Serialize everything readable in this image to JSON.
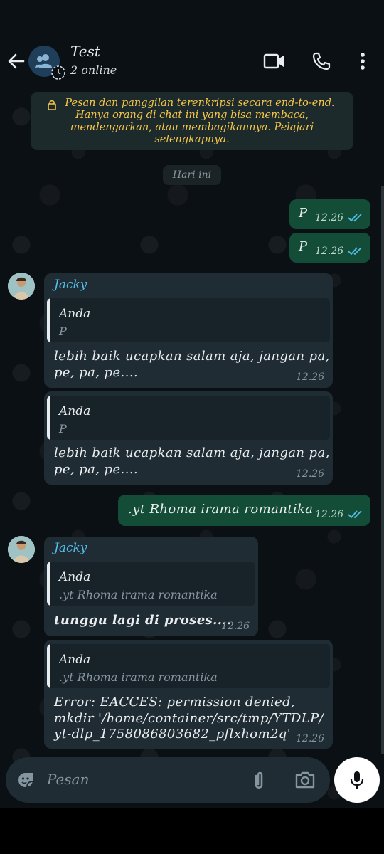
{
  "header": {
    "title": "Test",
    "subtitle": "2 online",
    "icons": [
      "back-arrow-icon",
      "group-avatar-icon",
      "video-call-icon",
      "voice-call-icon",
      "more-vert-icon"
    ]
  },
  "notice": {
    "text": "Pesan dan panggilan terenkripsi secara end-to-end. Hanya orang di chat ini yang bisa membaca, mendengarkan, atau membagikannya. Pelajari selengkapnya.",
    "line1": "Pesan dan panggilan terenkripsi secara end-to-end.",
    "line2": "Hanya orang di chat ini yang bisa membaca,",
    "line3": "mendengarkan, atau membagikannya. Pelajari",
    "line4": "selengkapnya."
  },
  "date_chip": "Hari ini",
  "messages": {
    "m1": {
      "text": "P",
      "time": "12.26"
    },
    "m2": {
      "text": "P",
      "time": "12.26"
    },
    "m3": {
      "sender": "Jacky",
      "quote_author": "Anda",
      "quote_text": "P",
      "line1": "lebih baik ucapkan salam aja, jangan pa,",
      "line2": "pe, pa, pe....",
      "time": "12.26"
    },
    "m4": {
      "quote_author": "Anda",
      "quote_text": "P",
      "line1": "lebih baik ucapkan salam aja, jangan pa,",
      "line2": "pe, pa, pe....",
      "time": "12.26"
    },
    "m5": {
      "text": ".yt Rhoma irama romantika",
      "time": "12.26"
    },
    "m6": {
      "sender": "Jacky",
      "quote_author": "Anda",
      "quote_text": ".yt Rhoma irama romantika",
      "text": "tunggu lagi di proses....",
      "time": "12.26"
    },
    "m7": {
      "quote_author": "Anda",
      "quote_text": ".yt Rhoma irama romantika",
      "line1": "Error: EACCES: permission denied,",
      "line2": "mkdir '/home/container/src/tmp/YTDLP/",
      "line3": "yt-dlp_1758086803682_pflxhom2q'",
      "time": "12.26"
    }
  },
  "input": {
    "placeholder": "Pesan"
  },
  "colors": {
    "accent": "#53bdeb",
    "outgoing": "#134d37",
    "incoming": "#1f2c33",
    "notice": "#f5c64a"
  }
}
